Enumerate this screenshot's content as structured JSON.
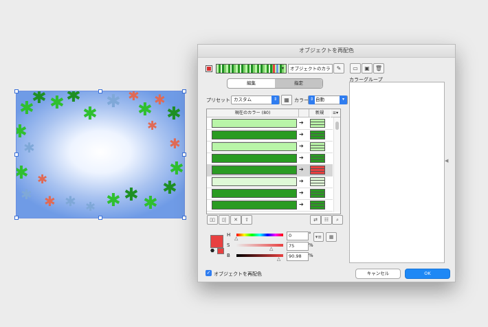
{
  "dialog": {
    "title": "オブジェクトを再配色",
    "name_field": "オブジェクトのカラー",
    "tabs": [
      "編集",
      "指定"
    ],
    "preset_label": "プリセット：",
    "preset_value": "カスタム",
    "color_label": "カラー：",
    "color_value": "自動",
    "table_headers": {
      "current": "現在のカラー (80)",
      "new": "新規"
    },
    "color_group_label": "カラーグループ",
    "hsb": {
      "h_label": "H",
      "s_label": "S",
      "b_label": "B",
      "h_value": "0",
      "s_value": "75",
      "b_value": "90.98",
      "h_unit": "°",
      "s_unit": "%",
      "b_unit": "%",
      "h_level": 0,
      "s_level": 0.75,
      "b_level": 0.9098
    },
    "recolor_checkbox": "オブジェクトを再配色",
    "recolor_checked": true,
    "cancel_label": "キャンセル",
    "ok_label": "OK"
  },
  "rows": [
    {
      "current": "#b9f5a8",
      "new": "#b9f5a8",
      "new_lines": true,
      "selected": false
    },
    {
      "current": "#2a9b22",
      "new": "#2a9b22",
      "new_lines": true,
      "selected": false
    },
    {
      "current": "#b9f5a8",
      "new": "#b9f5a8",
      "new_lines": true,
      "selected": false
    },
    {
      "current": "#2a9b22",
      "new": "#2a9b22",
      "new_lines": true,
      "selected": false
    },
    {
      "current": "#2a9b22",
      "new": "#e84040",
      "new_lines": true,
      "selected": true
    },
    {
      "current": "#dff9d6",
      "new": "#dff9d6",
      "new_lines": true,
      "selected": false
    },
    {
      "current": "#2a9b22",
      "new": "#2a9b22",
      "new_lines": true,
      "selected": false
    },
    {
      "current": "#2a9b22",
      "new": "#2a9b22",
      "new_lines": true,
      "selected": false
    }
  ],
  "colors": {
    "accent": "#2f7df0",
    "selected_swatch": "#e84040",
    "ok_button": "#1e88f5"
  }
}
